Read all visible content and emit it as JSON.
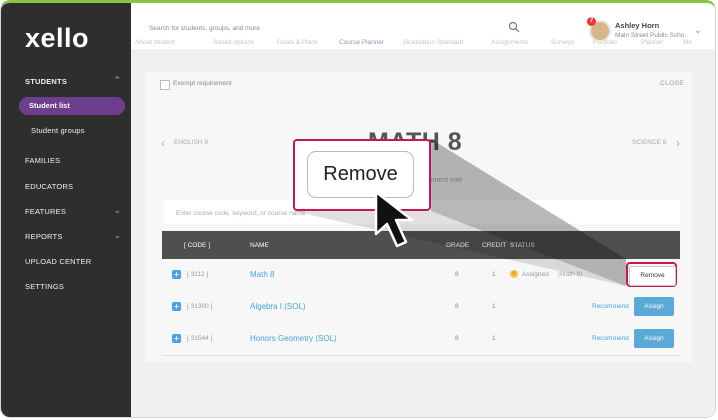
{
  "app": {
    "logo": "xello"
  },
  "sidebar": {
    "section_title": "STUDENTS",
    "items": [
      {
        "label": "Student list",
        "selected": true
      },
      {
        "label": "Student groups"
      },
      {
        "label": "FAMILIES"
      },
      {
        "label": "EDUCATORS"
      },
      {
        "label": "FEATURES",
        "expandable": true
      },
      {
        "label": "REPORTS",
        "expandable": true
      },
      {
        "label": "UPLOAD CENTER"
      },
      {
        "label": "SETTINGS"
      }
    ]
  },
  "header": {
    "search_placeholder": "Search for students, groups, and more",
    "tabs": [
      "About student",
      "Saved options",
      "Goals & Plans",
      "Course Planner",
      "Graduation Standard",
      "Assignments",
      "Surveys",
      "Portfolio",
      "Planner",
      "Me"
    ],
    "user": {
      "name": "Ashley Horn",
      "school": "Main Street Public Scho...",
      "notification_count": "7"
    }
  },
  "course_panel": {
    "exempt_label": "Exempt requirement",
    "close_label": "CLOSE",
    "prev_course": "ENGLISH 8",
    "next_course": "SCIENCE 8",
    "title": "MATH 8",
    "requirement_text": "Requirement met",
    "search_placeholder": "Enter course code, keyword, or course name"
  },
  "table": {
    "headers": {
      "code": "[ CODE ]",
      "name": "NAME",
      "grade": "GRADE",
      "credit": "CREDIT",
      "status": "STATUS"
    },
    "rows": [
      {
        "code": "[ 3112 ]",
        "name": "Math 8",
        "grade": "8",
        "credit": "1",
        "status": "Assigned",
        "status_detail": "(Math 8)",
        "action": "Remove"
      },
      {
        "code": "[ 31300 ]",
        "name": "Algebra I (SOL)",
        "grade": "8",
        "credit": "1",
        "recommend": "Recommend",
        "action": "Assign"
      },
      {
        "code": "[ 31544 ]",
        "name": "Honors Geometry (SOL)",
        "grade": "8",
        "credit": "1",
        "recommend": "Recommend",
        "action": "Assign"
      }
    ]
  },
  "callout": {
    "label": "Remove"
  },
  "colors": {
    "sidebar_bg": "#2e2e2e",
    "selected_nav": "#6d3d8e",
    "accent_blue": "#4aa3df",
    "highlight_pink": "#c2185b"
  }
}
